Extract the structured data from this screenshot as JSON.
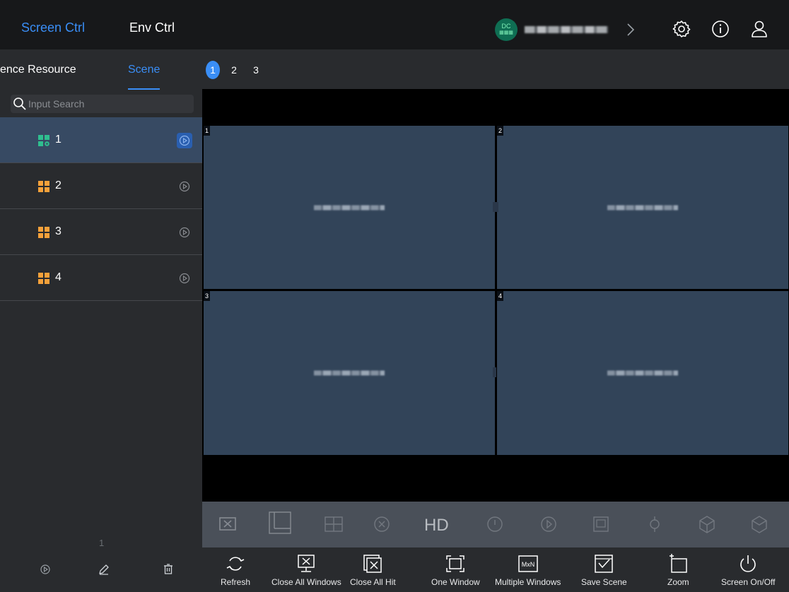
{
  "top_tabs": {
    "screen_ctrl": "Screen Ctrl",
    "env_ctrl": "Env Ctrl"
  },
  "device": {
    "badge_line1": "DC",
    "badge_line2": "▦▦▦"
  },
  "left_panel": {
    "subtab_resource": "ence Resource",
    "subtab_scene": "Scene",
    "search_placeholder": "Input Search",
    "scenes": [
      {
        "label": "1",
        "selected": true
      },
      {
        "label": "2",
        "selected": false
      },
      {
        "label": "3",
        "selected": false
      },
      {
        "label": "4",
        "selected": false
      }
    ],
    "page": "1"
  },
  "screen_pages": [
    "1",
    "2",
    "3"
  ],
  "windows": [
    {
      "num": "1"
    },
    {
      "num": "2"
    },
    {
      "num": "3"
    },
    {
      "num": "4"
    }
  ],
  "disabled_toolbar": {
    "hd": "HD"
  },
  "toolbar": {
    "refresh": "Refresh",
    "close_all_windows": "Close All Windows",
    "close_all_hit": "Close All Hit",
    "one_window": "One Window",
    "multiple_windows": "Multiple Windows",
    "multiple_windows_icon_text": "MxN",
    "save_scene": "Save Scene",
    "zoom": "Zoom",
    "screen_onoff": "Screen On/Off"
  },
  "colors": {
    "accent": "#3a8ef6",
    "window": "#324459",
    "selected_row": "#374a63",
    "scene_selected_icon": "#2fbf8f",
    "scene_icon": "#f5a13a"
  }
}
